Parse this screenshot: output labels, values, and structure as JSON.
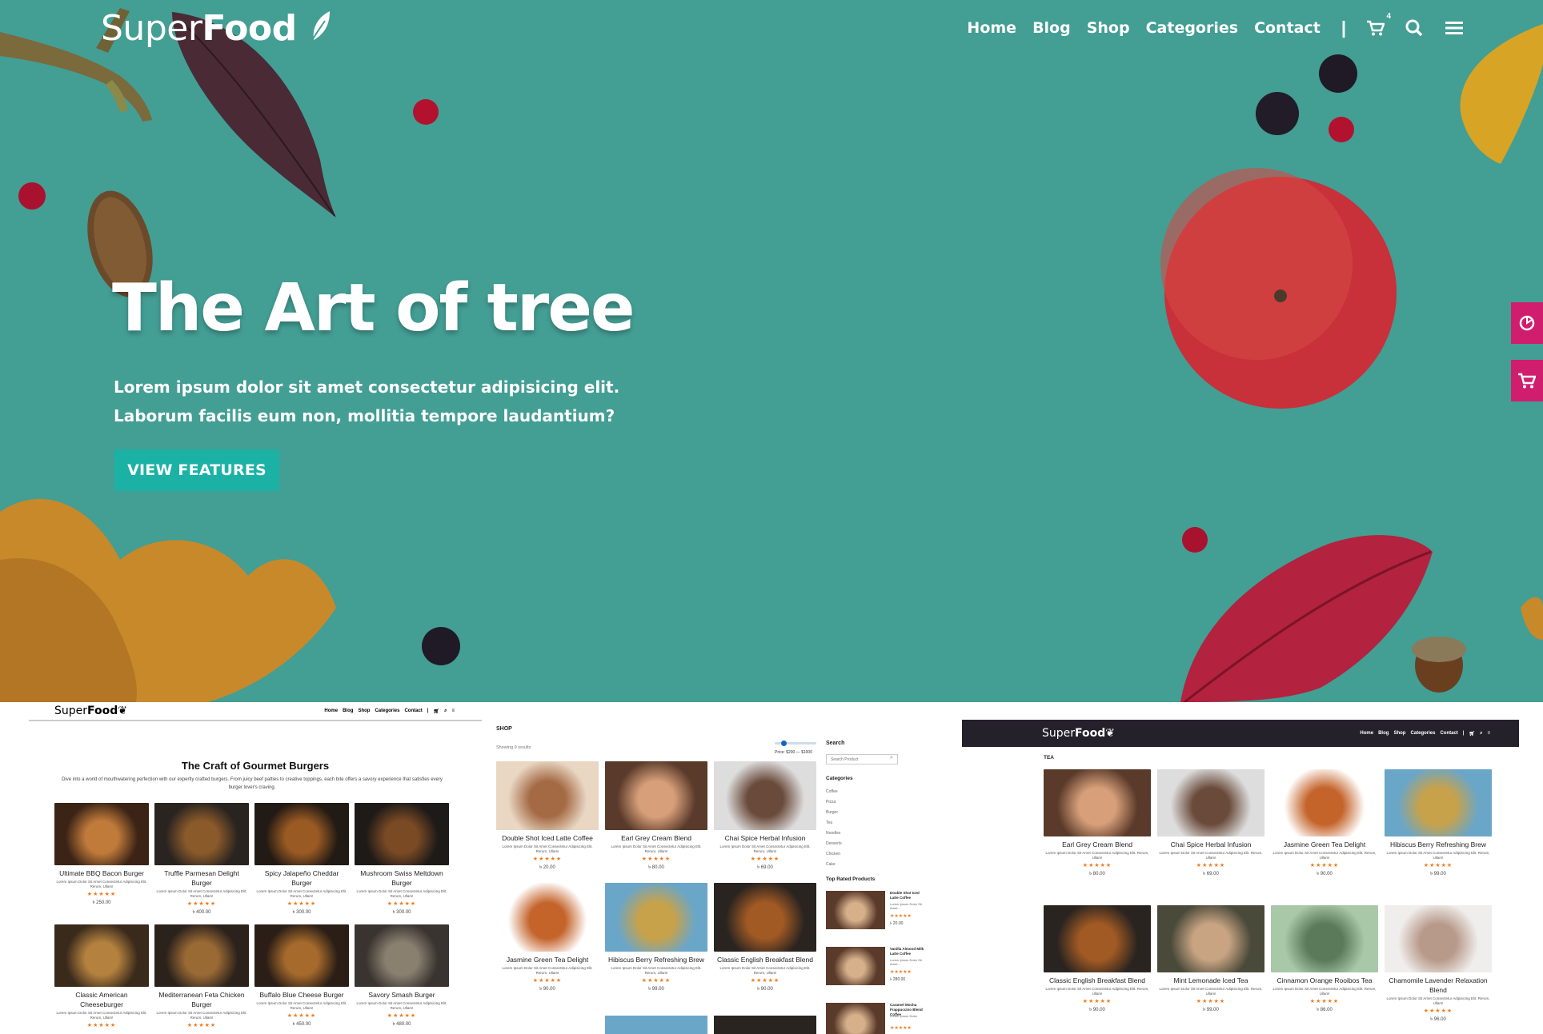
{
  "colors": {
    "hero_bg": "#439e94",
    "button": "#1bb2a5",
    "side_tab": "#d11d6e",
    "star": "#f07b1d",
    "dark_header": "#25212b"
  },
  "brand": {
    "name_light": "Super",
    "name_bold": "Food"
  },
  "nav": {
    "items": [
      "Home",
      "Blog",
      "Shop",
      "Categories",
      "Contact"
    ],
    "separator": "|",
    "cart_count": "4",
    "icons": [
      "cart-icon",
      "search-icon",
      "menu-icon"
    ]
  },
  "hero": {
    "title": "The Art of tree",
    "subtitle": "Lorem ipsum dolor sit amet consectetur adipisicing elit. Laborum facilis eum non, mollitia tempore laudantium?",
    "button": "VIEW FEATURES"
  },
  "side_tabs": [
    "support-icon",
    "cart-icon"
  ],
  "panel1": {
    "logo_light": "Super",
    "logo_bold": "Food",
    "nav": [
      "Home",
      "Blog",
      "Shop",
      "Categories",
      "Contact"
    ],
    "title": "The Craft of Gourmet Burgers",
    "intro": "Dive into a world of mouthwatering perfection with our expertly crafted burgers. From juicy beef patties to creative toppings, each bite offers a savory experience that satisfies every burger lover's craving.",
    "desc": "Lorem Ipsum Dolor Sit Amet Consectetur Adipisicing Elit. Rerum, Ullam!",
    "stars": "★★★★★",
    "products": [
      {
        "name": "Ultimate BBQ Bacon Burger",
        "price": "৳ 250.00"
      },
      {
        "name": "Truffle Parmesan Delight Burger",
        "price": "৳ 400.00"
      },
      {
        "name": "Spicy Jalapeño Cheddar Burger",
        "price": "৳ 300.00"
      },
      {
        "name": "Mushroom Swiss Meltdown Burger",
        "price": "৳ 300.00"
      },
      {
        "name": "Classic American Cheeseburger",
        "price": ""
      },
      {
        "name": "Mediterranean Feta Chicken Burger",
        "price": ""
      },
      {
        "name": "Buffalo Blue Cheese Burger",
        "price": "৳ 450.00"
      },
      {
        "name": "Savory Smash Burger",
        "price": "৳ 480.00"
      }
    ]
  },
  "panel2": {
    "heading": "SHOP",
    "results": "Showing 9 results",
    "price_label": "Price: $200 — $1000",
    "search_label": "Search",
    "search_placeholder": "Search Product",
    "categories_label": "Categories",
    "categories": [
      "Coffee",
      "Pizza",
      "Burger",
      "Tea",
      "Noodles",
      "Desserts",
      "Chicken",
      "Cake"
    ],
    "top_rated_label": "Top Rated Products",
    "top_rated": [
      {
        "name": "Double Shot Iced Latte Coffee",
        "desc": "Lorem Ipsum Dolor Sit Amet...",
        "price": "৳ 20.00"
      },
      {
        "name": "Vanilla Almond Milk Latte Coffee",
        "desc": "Lorem Ipsum Dolor Sit Amet...",
        "price": "৳ 280.00"
      },
      {
        "name": "Caramel Mocha Frappuccino Blend Coffee",
        "desc": "Lorem Ipsum Dolor",
        "price": ""
      }
    ],
    "desc": "Lorem Ipsum Dolor Sit Amet Consectetur Adipisicing Elit. Rerum, Ullam!",
    "stars": "★★★★★",
    "products": [
      {
        "name": "Double Shot Iced Latte Coffee",
        "price": "৳ 20.00"
      },
      {
        "name": "Earl Grey Cream Blend",
        "price": "৳ 80.00"
      },
      {
        "name": "Chai Spice Herbal Infusion",
        "price": "৳ 69.00"
      },
      {
        "name": "Jasmine Green Tea Delight",
        "price": "৳ 90.00"
      },
      {
        "name": "Hibiscus Berry Refreshing Brew",
        "price": "৳ 99.00"
      },
      {
        "name": "Classic English Breakfast Blend",
        "price": "৳ 90.00"
      }
    ]
  },
  "panel3": {
    "logo_light": "Super",
    "logo_bold": "Food",
    "nav": [
      "Home",
      "Blog",
      "Shop",
      "Categories",
      "Contact"
    ],
    "section": "TEA",
    "desc": "Lorem Ipsum Dolor Sit Amet Consectetur Adipisicing Elit. Rerum, Ullam!",
    "stars": "★★★★★",
    "products": [
      {
        "name": "Earl Grey Cream Blend",
        "price": "৳ 80.00"
      },
      {
        "name": "Chai Spice Herbal Infusion",
        "price": "৳ 69.00"
      },
      {
        "name": "Jasmine Green Tea Delight",
        "price": "৳ 90.00"
      },
      {
        "name": "Hibiscus Berry Refreshing Brew",
        "price": "৳ 99.00"
      },
      {
        "name": "Classic English Breakfast Blend",
        "price": "৳ 90.00"
      },
      {
        "name": "Mint Lemonade Iced Tea",
        "price": "৳ 99.00"
      },
      {
        "name": "Cinnamon Orange Rooibos Tea",
        "price": "৳ 86.00"
      },
      {
        "name": "Chamomile Lavender Relaxation Blend",
        "price": "৳ 96.00"
      }
    ]
  }
}
